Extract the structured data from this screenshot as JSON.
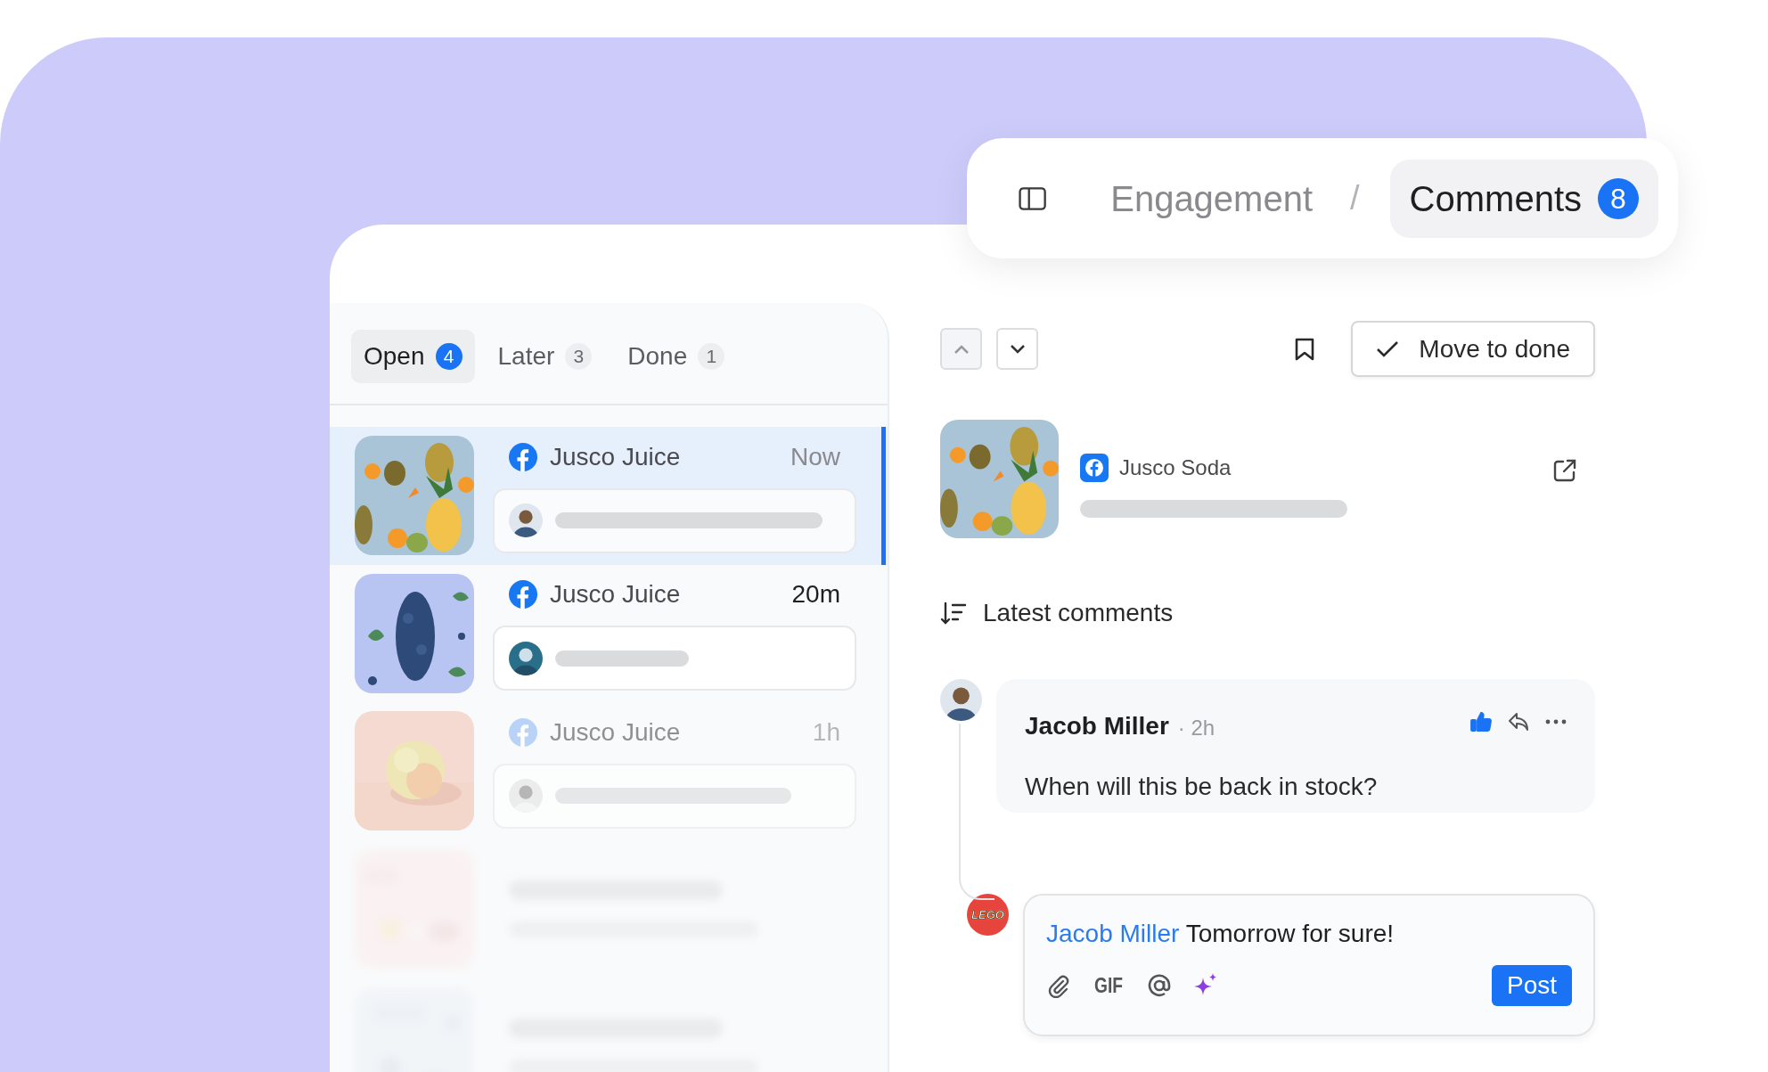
{
  "breadcrumb": {
    "items": [
      {
        "label": "Engagement",
        "selected": false
      },
      {
        "label": "Comments",
        "selected": true,
        "count": "8"
      }
    ],
    "separator": "/"
  },
  "inbox": {
    "tabs": [
      {
        "label": "Open",
        "count": "4",
        "selected": true
      },
      {
        "label": "Later",
        "count": "3",
        "selected": false
      },
      {
        "label": "Done",
        "count": "1",
        "selected": false
      }
    ],
    "items": [
      {
        "kind": "item",
        "account": "Jusco Juice",
        "time": "Now",
        "selected": true,
        "unread": false,
        "dimmed": false
      },
      {
        "kind": "item",
        "account": "Jusco Juice",
        "time": "20m",
        "selected": false,
        "unread": true,
        "dimmed": false
      },
      {
        "kind": "item",
        "account": "Jusco Juice",
        "time": "1h",
        "selected": false,
        "unread": false,
        "dimmed": true
      },
      {
        "kind": "ghost"
      },
      {
        "kind": "ghost"
      }
    ]
  },
  "detail": {
    "toolbar": {
      "done_button": "Move to done"
    },
    "post": {
      "account": "Jusco Soda"
    },
    "sort_label": "Latest comments",
    "comment": {
      "author": "Jacob Miller",
      "separator": "·",
      "time": "2h",
      "text": "When will this be back in stock?",
      "liked": true
    },
    "reply": {
      "avatar_text": "LEGO",
      "mention": "Jacob Miller",
      "text": "Tomorrow for sure!",
      "gif_label": "GIF",
      "post_button": "Post"
    }
  }
}
